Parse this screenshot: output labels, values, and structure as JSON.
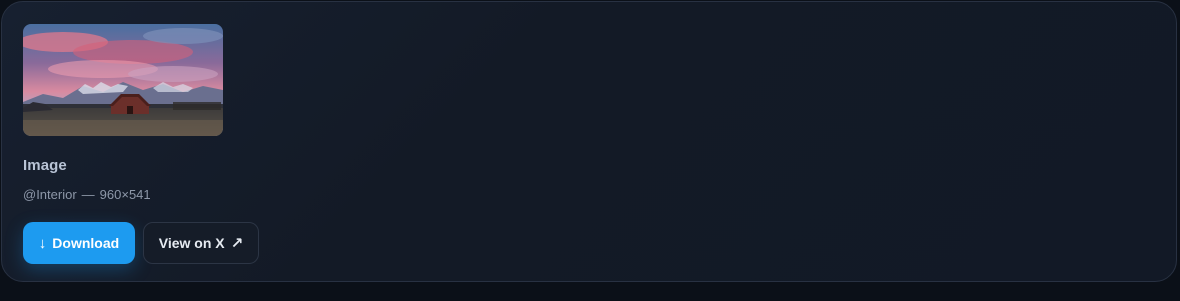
{
  "card": {
    "thumbnail_icon": "landscape-photo-barn-mountains-sunset",
    "title": "Image",
    "meta": {
      "handle": "@Interior",
      "separator": "—",
      "dimensions": "960×541"
    }
  },
  "actions": {
    "download": {
      "icon": "download-arrow-icon",
      "glyph": "↓",
      "label": "Download"
    },
    "view_on_x": {
      "label": "View on X",
      "icon": "external-link-arrow-icon",
      "glyph": "↗"
    }
  },
  "colors": {
    "accent": "#1d9bf0",
    "background": "#0b1018",
    "card": "#131a26"
  }
}
